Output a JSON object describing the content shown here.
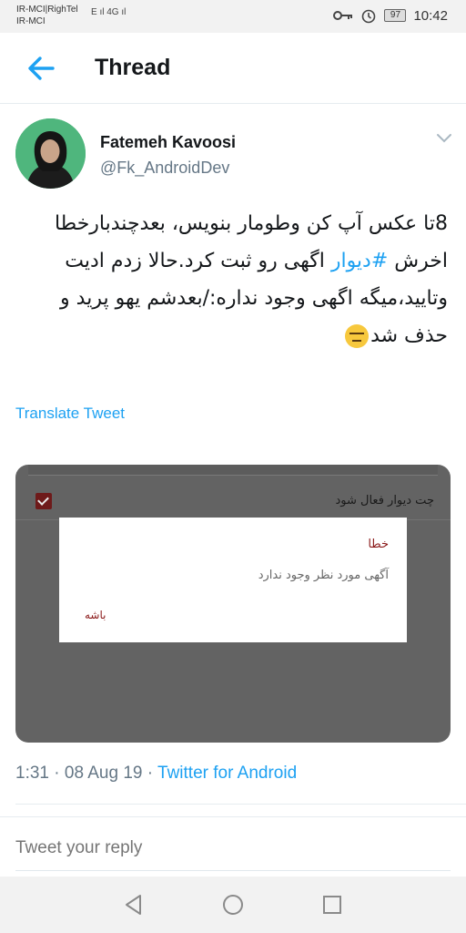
{
  "status_bar": {
    "carrier_line1": "IR-MCI|RighTel",
    "carrier_line2": "IR-MCI",
    "signal_text": "E ıl 4G ıl",
    "battery": "97",
    "time": "10:42"
  },
  "header": {
    "title": "Thread"
  },
  "tweet": {
    "author_name": "Fatemeh Kavoosi",
    "author_handle": "@Fk_AndroidDev",
    "text_part1": "8تا عکس آپ کن وطومار بنویس، بعدچندبارخطا اخرش ",
    "hashtag": "#دیوار",
    "text_part2": " اگهی رو ثبت کرد.حالا زدم ادیت وتایید،میگه اگهی وجود نداره:/بعدشم یهو پرید و حذف شد",
    "emoji": "unamused-face",
    "translate_label": "Translate Tweet",
    "media": {
      "checkbox_label": "چت دیوار فعال شود",
      "dialog_title": "خطا",
      "dialog_message": "آگهی مورد نظر وجود ندارد",
      "dialog_button": "باشه"
    },
    "time": "1:31",
    "date": "08 Aug 19",
    "source": "Twitter for Android"
  },
  "reply": {
    "placeholder": "Tweet your reply"
  },
  "colors": {
    "accent": "#1da1f2",
    "secondary_text": "#657786",
    "dialog_red": "#8b1a1a"
  }
}
